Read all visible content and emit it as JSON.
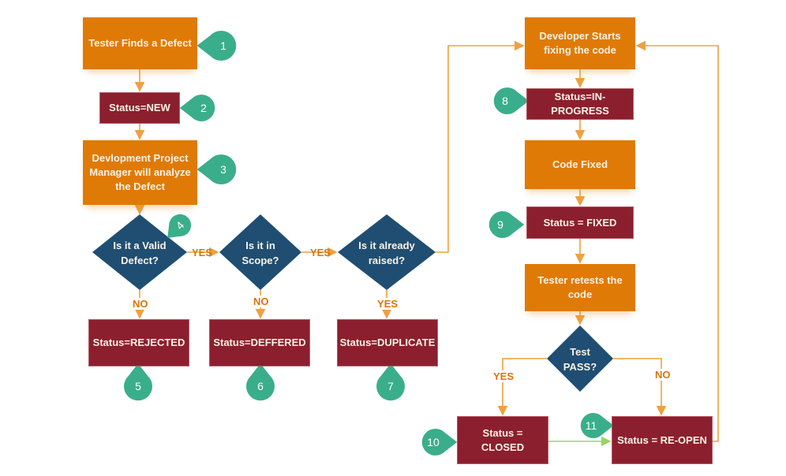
{
  "colors": {
    "process": "#e07a06",
    "status": "#8c1f2e",
    "decision": "#1f4e72",
    "marker": "#3aae8a",
    "arrow": "#f0a040",
    "green_arrow": "#9ad36a"
  },
  "nodes": {
    "tester_finds": "Tester Finds a Defect",
    "status_new": "Status=NEW",
    "pm_analyze": "Devlopment Project Manager will analyze the Defect",
    "status_rejected": "Status=REJECTED",
    "status_deferred": "Status=DEFFERED",
    "status_duplicate": "Status=DUPLICATE",
    "dev_fixing": "Developer Starts fixing the code",
    "status_in_progress": "Status=IN-PROGRESS",
    "code_fixed": "Code Fixed",
    "status_fixed": "Status = FIXED",
    "tester_retests": "Tester retests the code",
    "status_closed": "Status = CLOSED",
    "status_reopen": "Status = RE-OPEN"
  },
  "decisions": {
    "valid": [
      "Is it a Valid",
      "Defect?"
    ],
    "scope": [
      "Is it in",
      "Scope?"
    ],
    "raised": [
      "Is it already",
      "raised?"
    ],
    "test_pass": [
      "Test",
      "PASS?"
    ]
  },
  "edge_labels": {
    "valid_yes": "YES",
    "scope_yes": "YES",
    "valid_no": "NO",
    "scope_no": "NO",
    "raised_yes": "YES",
    "pass_yes": "YES",
    "pass_no": "NO"
  },
  "markers": [
    "1",
    "2",
    "3",
    "4",
    "5",
    "6",
    "7",
    "8",
    "9",
    "10",
    "11"
  ]
}
